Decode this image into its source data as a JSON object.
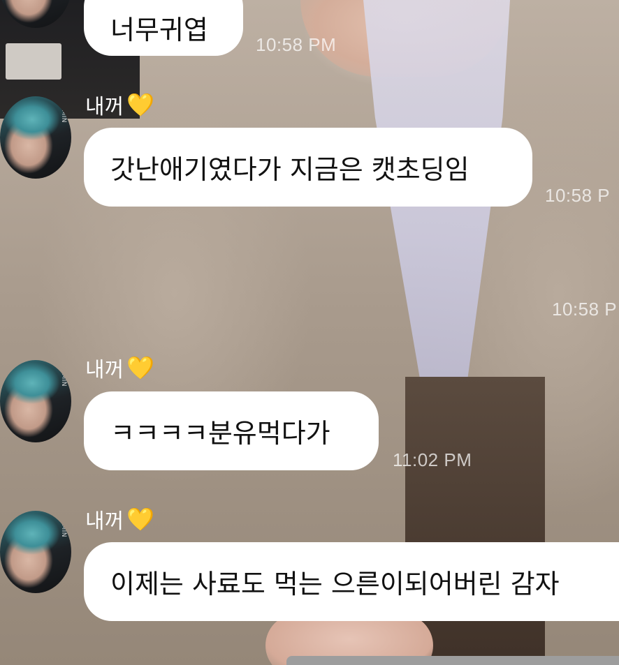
{
  "messages": [
    {
      "sender": "",
      "heart": "",
      "text": "너무귀엽",
      "time": "10:58 PM"
    },
    {
      "sender": "내꺼",
      "heart": "💛",
      "text": "갓난애기였다가 지금은 캣초딩임",
      "time": "10:58 P"
    },
    {
      "sender": "",
      "heart": "",
      "text": "",
      "time": "10:58 P"
    },
    {
      "sender": "내꺼",
      "heart": "💛",
      "text": "ㅋㅋㅋㅋ분유먹다가",
      "time": "11:02 PM"
    },
    {
      "sender": "내꺼",
      "heart": "💛",
      "text": "이제는 사료도 먹는 으른이되어버린 감자",
      "time": ""
    }
  ],
  "avatar": {
    "logo_text": "JIMIN",
    "icon": "profile-avatar"
  },
  "colors": {
    "bubble": "#ffffff",
    "text": "#111111",
    "heart": "#f7c21d",
    "time": "rgba(255,255,255,0.72)"
  }
}
